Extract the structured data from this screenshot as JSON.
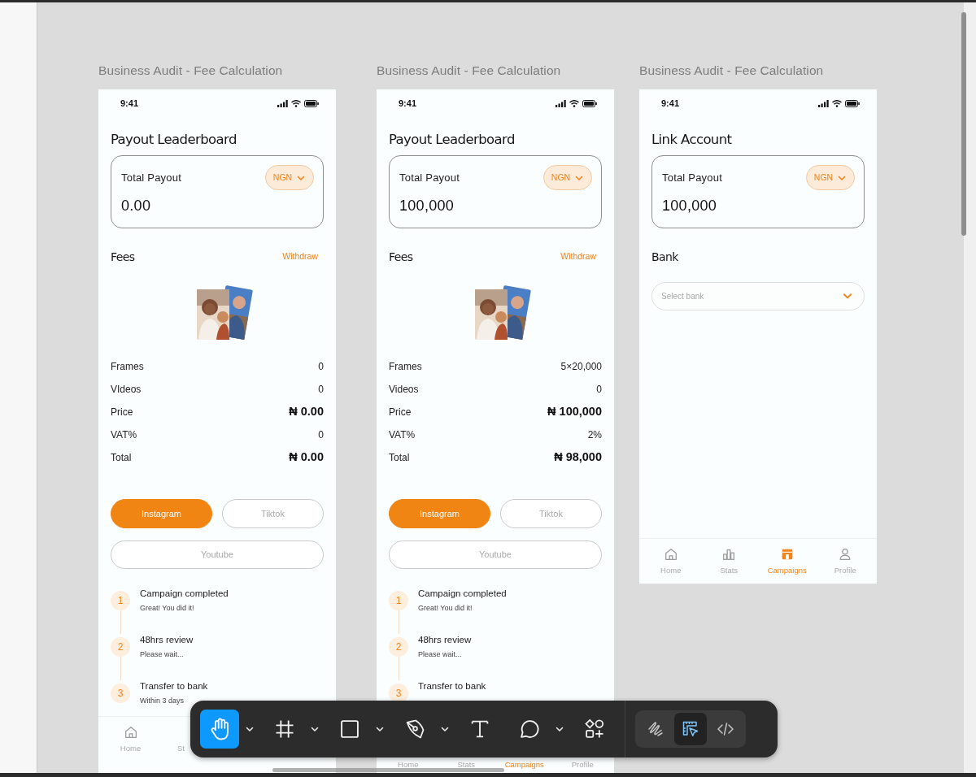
{
  "frames": [
    {
      "kind": "fees",
      "title": "Business Audit - Fee Calculation",
      "time": "9:41",
      "heading": "Payout Leaderboard",
      "payout": {
        "label": "Total Payout",
        "currency": "NGN",
        "amount": "0.00"
      },
      "section_title": "Fees",
      "action": "Withdraw",
      "rows": [
        {
          "label": "Frames",
          "value": "0",
          "emphasis": false
        },
        {
          "label": "VIdeos",
          "value": "0",
          "emphasis": false
        },
        {
          "label": "Price",
          "value": "₦ 0.00",
          "emphasis": true
        },
        {
          "label": "VAT%",
          "value": "0",
          "emphasis": false
        },
        {
          "label": "Total",
          "value": "₦ 0.00",
          "emphasis": true
        }
      ],
      "platforms": [
        {
          "label": "Instagram",
          "selected": true
        },
        {
          "label": "Tiktok",
          "selected": false
        },
        {
          "label": "Youtube",
          "selected": false
        }
      ],
      "steps": [
        {
          "number": "1",
          "title": "Campaign completed",
          "subtitle": "Great! You did it!"
        },
        {
          "number": "2",
          "title": "48hrs review",
          "subtitle": "Please wait..."
        },
        {
          "number": "3",
          "title": "Transfer to bank",
          "subtitle": "Within 3 days"
        }
      ],
      "nav": {
        "icons_visible": true,
        "items": [
          {
            "kind": "home",
            "label": "Home",
            "selected": false
          },
          {
            "label": "St",
            "selected": false
          }
        ]
      }
    },
    {
      "kind": "fees",
      "title": "Business Audit - Fee Calculation",
      "time": "9:41",
      "heading": "Payout Leaderboard",
      "payout": {
        "label": "Total Payout",
        "currency": "NGN",
        "amount": "100,000"
      },
      "section_title": "Fees",
      "action": "Withdraw",
      "rows": [
        {
          "label": "Frames",
          "value": "5×20,000",
          "emphasis": false
        },
        {
          "label": "Videos",
          "value": "0",
          "emphasis": false
        },
        {
          "label": "Price",
          "value": "₦ 100,000",
          "emphasis": true
        },
        {
          "label": "VAT%",
          "value": "2%",
          "emphasis": false
        },
        {
          "label": "Total",
          "value": "₦ 98,000",
          "emphasis": true
        }
      ],
      "platforms": [
        {
          "label": "Instagram",
          "selected": true
        },
        {
          "label": "Tiktok",
          "selected": false
        },
        {
          "label": "Youtube",
          "selected": false
        }
      ],
      "steps": [
        {
          "number": "1",
          "title": "Campaign completed",
          "subtitle": "Great! You did it!"
        },
        {
          "number": "2",
          "title": "48hrs review",
          "subtitle": "Please wait..."
        },
        {
          "number": "3",
          "title": "Transfer to bank"
        }
      ],
      "nav": {
        "icons_visible": false,
        "items": [
          {
            "label": "Home",
            "selected": false
          },
          {
            "label": "Stats",
            "selected": false
          },
          {
            "label": "Campaigns",
            "selected": true
          },
          {
            "label": "Profile",
            "selected": false
          }
        ]
      }
    },
    {
      "kind": "link",
      "title": "Business Audit - Fee Calculation",
      "time": "9:41",
      "heading": "Link Account",
      "payout": {
        "label": "Total Payout",
        "currency": "NGN",
        "amount": "100,000"
      },
      "section_title": "Bank",
      "select": {
        "placeholder": "Select bank"
      },
      "nav": {
        "icons_visible": true,
        "items": [
          {
            "kind": "home",
            "label": "Home",
            "selected": false
          },
          {
            "kind": "stats",
            "label": "Stats",
            "selected": false
          },
          {
            "kind": "campaigns",
            "label": "Campaigns",
            "selected": true
          },
          {
            "kind": "profile",
            "label": "Profile",
            "selected": false
          }
        ]
      }
    }
  ],
  "toolbar": {
    "tools": [
      {
        "kind": "hand",
        "selected": true,
        "menu": true
      },
      {
        "kind": "frame",
        "selected": false,
        "menu": true
      },
      {
        "kind": "rectangle",
        "selected": false,
        "menu": true
      },
      {
        "kind": "pen",
        "selected": false,
        "menu": true
      },
      {
        "kind": "text",
        "selected": false,
        "menu": false
      },
      {
        "kind": "comment",
        "selected": false,
        "menu": true
      },
      {
        "kind": "shapes",
        "selected": false,
        "menu": false
      }
    ],
    "modes": [
      {
        "kind": "draw",
        "selected": false
      },
      {
        "kind": "design",
        "selected": true
      },
      {
        "kind": "code",
        "selected": false
      }
    ]
  }
}
